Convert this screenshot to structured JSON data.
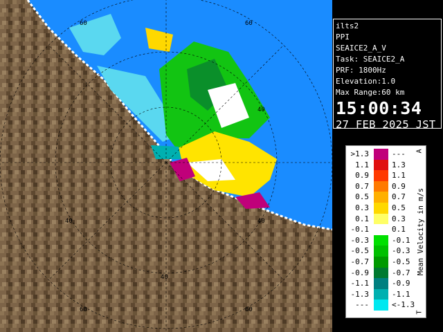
{
  "info": {
    "site": "ilts2",
    "product": "PPI",
    "scan": "SEAICE2_A_V",
    "task": "Task: SEAICE2_A",
    "prf": "PRF: 1800Hz",
    "elevation": "Elevation:1.0",
    "max_range": "Max Range:60 km",
    "time": "15:00:34",
    "date": "27 FEB 2025 JST"
  },
  "legend": {
    "title": "Mean Velocity in m/s",
    "cap_top": "A",
    "cap_bottom": "T",
    "rows": [
      {
        "left": ">1.3",
        "right": "---",
        "color": "#c0007a"
      },
      {
        "left": "1.1",
        "right": "1.3",
        "color": "#e01010"
      },
      {
        "left": "0.9",
        "right": "1.1",
        "color": "#ff3a00"
      },
      {
        "left": "0.7",
        "right": "0.9",
        "color": "#ff7a00"
      },
      {
        "left": "0.5",
        "right": "0.7",
        "color": "#ffb000"
      },
      {
        "left": "0.3",
        "right": "0.5",
        "color": "#ffd800"
      },
      {
        "left": "0.1",
        "right": "0.3",
        "color": "#ffff66"
      },
      {
        "left": "-0.1",
        "right": "0.1",
        "color": "#ffffff"
      },
      {
        "left": "-0.3",
        "right": "-0.1",
        "color": "#00e000"
      },
      {
        "left": "-0.5",
        "right": "-0.3",
        "color": "#00c000"
      },
      {
        "left": "-0.7",
        "right": "-0.5",
        "color": "#009a00"
      },
      {
        "left": "-0.9",
        "right": "-0.7",
        "color": "#007a30"
      },
      {
        "left": "-1.1",
        "right": "-0.9",
        "color": "#008080"
      },
      {
        "left": "-1.3",
        "right": "-1.1",
        "color": "#00b0b0"
      },
      {
        "left": "---",
        "right": "<-1.3",
        "color": "#00e8f0"
      }
    ]
  },
  "map": {
    "range_labels": [
      "60",
      "40",
      "40",
      "40",
      "40",
      "60",
      "60",
      "60"
    ],
    "colors": {
      "sea": "#1a8cff",
      "land": "#7a6246",
      "ice_cyan": "#5ad8f0",
      "grid": "#000000"
    }
  }
}
